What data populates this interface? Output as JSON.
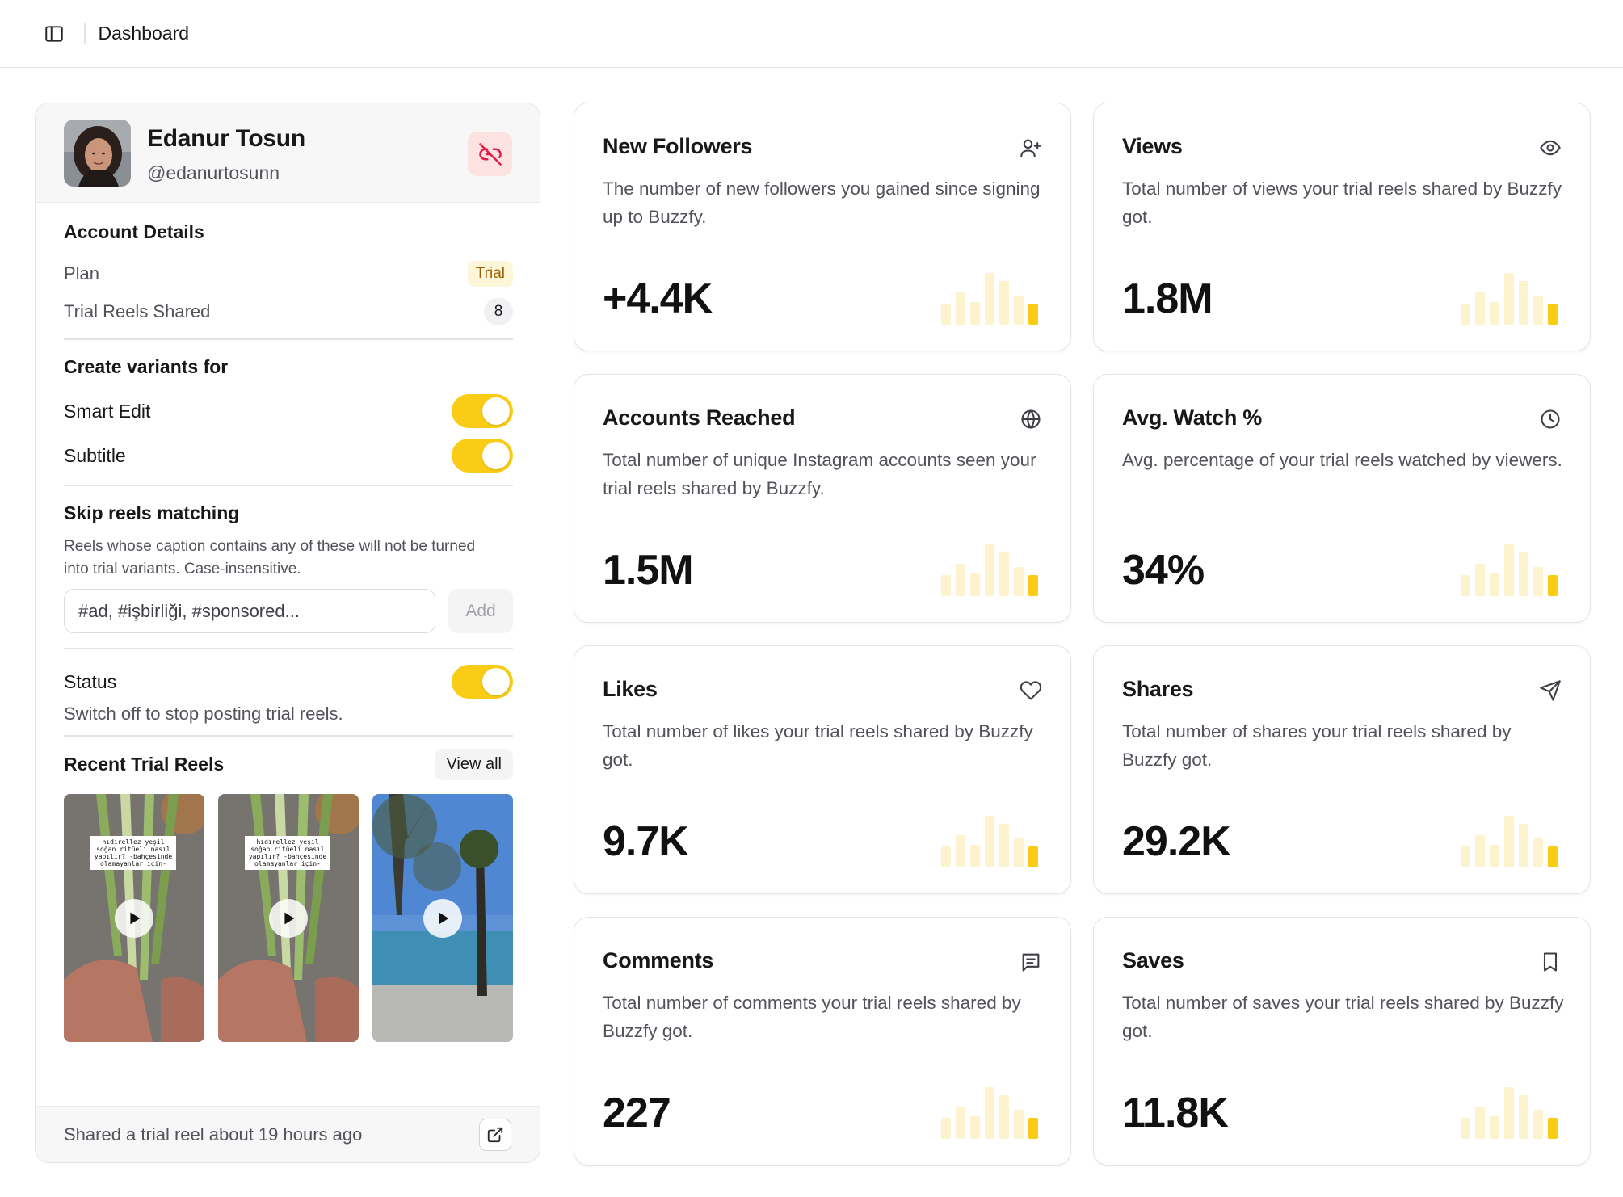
{
  "topbar": {
    "title": "Dashboard"
  },
  "profile": {
    "name": "Edanur Tosun",
    "handle": "@edanurtosunn",
    "account_details": {
      "title": "Account Details",
      "plan_label": "Plan",
      "plan_value": "Trial",
      "reels_label": "Trial Reels Shared",
      "reels_count": "8"
    },
    "variants": {
      "title": "Create variants for",
      "smart_edit": "Smart Edit",
      "subtitle": "Subtitle",
      "smart_edit_on": true,
      "subtitle_on": true
    },
    "skip": {
      "title": "Skip reels matching",
      "description": "Reels whose caption contains any of these will not be turned into trial variants. Case-insensitive.",
      "placeholder": "#ad, #işbirliği, #sponsored...",
      "add_label": "Add"
    },
    "status": {
      "title": "Status",
      "description": "Switch off to stop posting trial reels.",
      "on": true
    },
    "recent": {
      "title": "Recent Trial Reels",
      "view_all": "View all",
      "reel_caption": "hıdırellez yeşil soğan ritüeli nasıl yapılır? -bahçesinde olamayanlar için-"
    },
    "footer": "Shared a trial reel about 19 hours ago"
  },
  "cards": [
    {
      "title": "New Followers",
      "description": "The number of new followers you gained since signing up to Buzzfy.",
      "value": "+4.4K",
      "icon": "user-plus-icon"
    },
    {
      "title": "Views",
      "description": "Total number of views your trial reels shared by Buzzfy got.",
      "value": "1.8M",
      "icon": "eye-icon"
    },
    {
      "title": "Accounts Reached",
      "description": "Total number of unique Instagram accounts seen your trial reels shared by Buzzfy.",
      "value": "1.5M",
      "icon": "globe-icon"
    },
    {
      "title": "Avg. Watch %",
      "description": "Avg. percentage of your trial reels watched by viewers.",
      "value": "34%",
      "icon": "clock-icon"
    },
    {
      "title": "Likes",
      "description": "Total number of likes your trial reels shared by Buzzfy got.",
      "value": "9.7K",
      "icon": "heart-icon"
    },
    {
      "title": "Shares",
      "description": "Total number of shares your trial reels shared by Buzzfy got.",
      "value": "29.2K",
      "icon": "send-icon"
    },
    {
      "title": "Comments",
      "description": "Total number of comments your trial reels shared by Buzzfy got.",
      "value": "227",
      "icon": "message-icon"
    },
    {
      "title": "Saves",
      "description": "Total number of saves your trial reels shared by Buzzfy got.",
      "value": "11.8K",
      "icon": "bookmark-icon"
    }
  ],
  "colors": {
    "accent": "#facc15",
    "bar_light": "#fdf3cf",
    "danger_bg": "#fde2e2",
    "danger": "#e11d48"
  }
}
